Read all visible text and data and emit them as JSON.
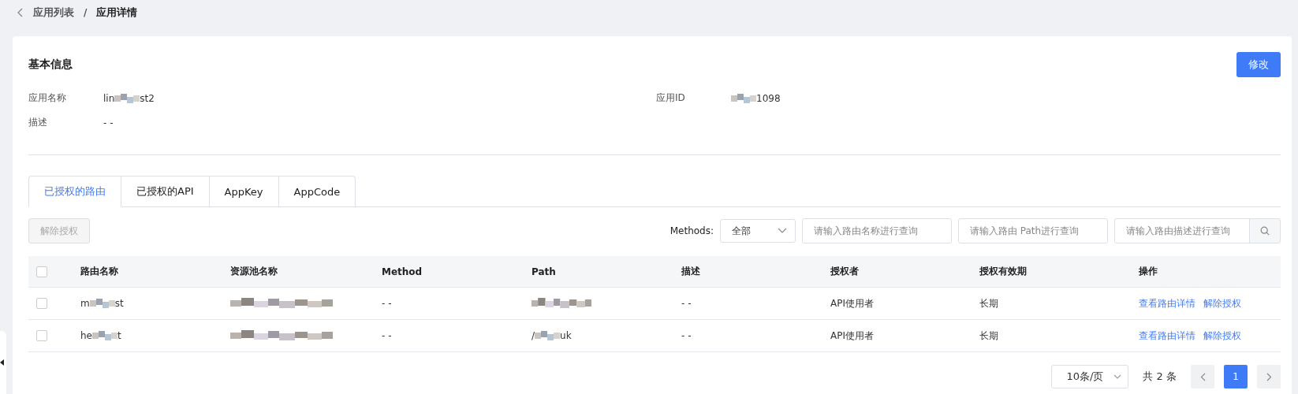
{
  "breadcrumb": {
    "separator": "/",
    "items": [
      {
        "label": "应用列表",
        "current": false
      },
      {
        "label": "应用详情",
        "current": true
      }
    ]
  },
  "basic_info": {
    "title": "基本信息",
    "edit_button": "修改",
    "fields": [
      {
        "label": "应用名称",
        "value": {
          "kind": "partial",
          "prefix": "lin",
          "suffix": "st2"
        }
      },
      {
        "label": "应用ID",
        "value": {
          "kind": "partial",
          "suffix": "1098"
        }
      },
      {
        "label": "描述",
        "value": {
          "kind": "text",
          "text": "- -"
        }
      }
    ]
  },
  "tabs": [
    {
      "label": "已授权的路由",
      "selected": true
    },
    {
      "label": "已授权的API",
      "selected": false
    },
    {
      "label": "AppKey",
      "selected": false
    },
    {
      "label": "AppCode",
      "selected": false
    }
  ],
  "toolbar": {
    "revoke_button": {
      "label": "解除授权",
      "disabled": true
    },
    "methods_label": "Methods:",
    "methods_select": "全部",
    "searches": [
      {
        "placeholder": "请输入路由名称进行查询"
      },
      {
        "placeholder": "请输入路由 Path进行查询"
      },
      {
        "placeholder": "请输入路由描述进行查询"
      }
    ]
  },
  "table": {
    "header_checked": false,
    "columns": [
      "路由名称",
      "资源池名称",
      "Method",
      "Path",
      "描述",
      "授权者",
      "授权有效期",
      "操作"
    ],
    "rows": [
      {
        "checked": false,
        "cells": [
          {
            "kind": "partial",
            "prefix": "m",
            "suffix": "st"
          },
          {
            "kind": "redacted"
          },
          {
            "kind": "text",
            "text": "- -"
          },
          {
            "kind": "redacted"
          },
          {
            "kind": "text",
            "text": "- -"
          },
          {
            "kind": "text",
            "text": "API使用者"
          },
          {
            "kind": "text",
            "text": "长期"
          }
        ],
        "actions": [
          "查看路由详情",
          "解除授权"
        ]
      },
      {
        "checked": false,
        "cells": [
          {
            "kind": "partial",
            "prefix": "he",
            "suffix": "t"
          },
          {
            "kind": "redacted"
          },
          {
            "kind": "text",
            "text": "- -"
          },
          {
            "kind": "partial",
            "prefix": "/",
            "suffix": "uk"
          },
          {
            "kind": "text",
            "text": "- -"
          },
          {
            "kind": "text",
            "text": "API使用者"
          },
          {
            "kind": "text",
            "text": "长期"
          }
        ],
        "actions": [
          "查看路由详情",
          "解除授权"
        ]
      }
    ]
  },
  "pagination": {
    "page_size": "10条/页",
    "total": "共 2 条",
    "pages": [
      {
        "label": "1",
        "selected": true
      }
    ]
  }
}
